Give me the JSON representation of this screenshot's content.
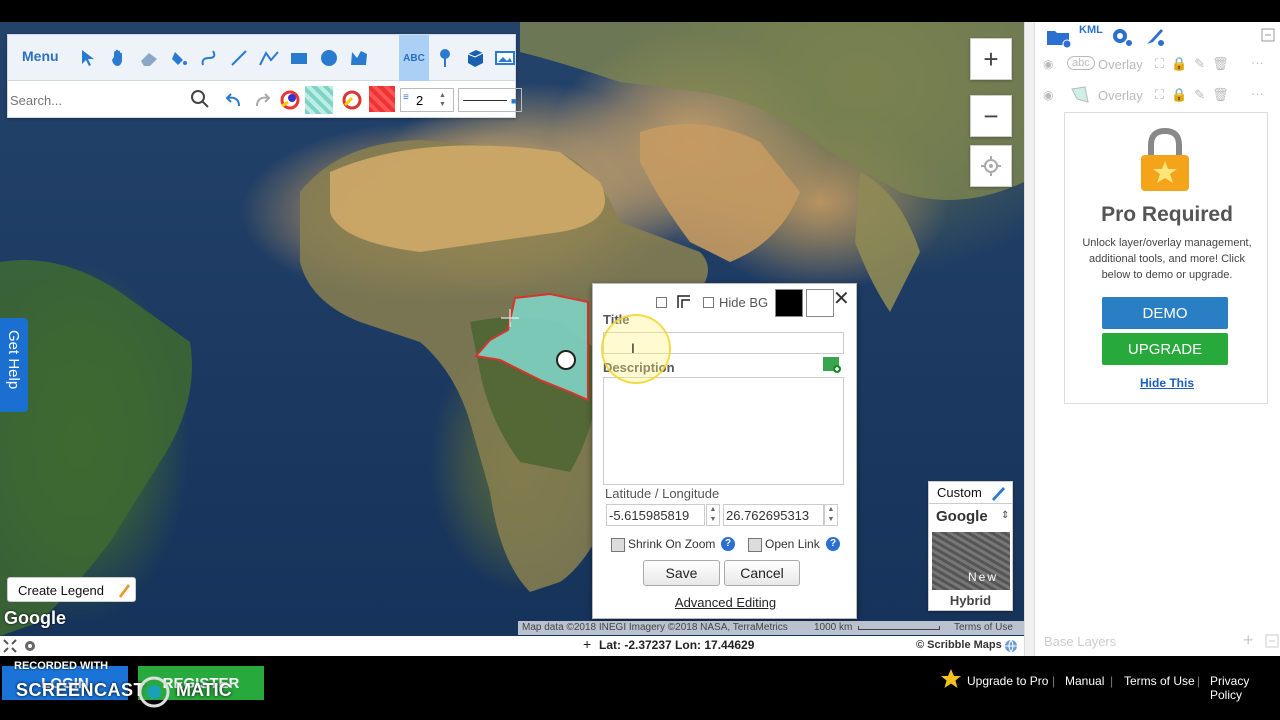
{
  "toolbar": {
    "menu_label": "Menu",
    "tools": [
      "select-icon",
      "pan-icon",
      "eraser-icon",
      "fill-icon",
      "freehand-icon",
      "line-icon",
      "polyline-icon",
      "rectangle-icon",
      "circle-icon",
      "polygon-icon",
      "text-icon",
      "marker-icon",
      "3d-icon",
      "image-icon"
    ],
    "text_tool_label": "ABC",
    "search_placeholder": "Search...",
    "stroke_width": "2"
  },
  "zoom": {
    "in_label": "+",
    "out_label": "−"
  },
  "get_help": "Get Help",
  "dialog": {
    "hide_bg_label": "Hide BG",
    "title_label": "Title",
    "description_label": "Description",
    "latlon_label": "Latitude / Longitude",
    "latitude": "-5.615985819",
    "longitude": "26.762695313",
    "shrink_label": "Shrink On Zoom",
    "open_link_label": "Open Link",
    "save_label": "Save",
    "cancel_label": "Cancel",
    "advanced_label": "Advanced Editing",
    "close_label": "✕",
    "help_glyph": "?"
  },
  "map_type": {
    "custom_label": "Custom",
    "provider": "Google",
    "provider_arrow": "⇕",
    "thumb_label": "New",
    "hybrid_label": "Hybrid"
  },
  "legend_label": "Create Legend",
  "google_logo": "Google",
  "attribution": {
    "text": "Map data ©2018 INEGI Imagery ©2018 NASA, TerraMetrics",
    "scale": "1000 km",
    "terms": "Terms of Use"
  },
  "status": {
    "coords": "Lat: -2.37237 Lon: 17.44629",
    "brand": "© Scribble Maps"
  },
  "right_panel": {
    "kml_label": "KML",
    "overlay_rows": [
      {
        "badge": "abc",
        "label": "Overlay"
      },
      {
        "badge": "",
        "label": "Overlay"
      }
    ],
    "pro_title": "Pro Required",
    "pro_text": "Unlock layer/overlay management, additional tools, and more! Click below to demo or upgrade.",
    "demo_label": "DEMO",
    "upgrade_label": "UPGRADE",
    "hide_label": "Hide This",
    "base_layers_label": "Base Layers"
  },
  "bottom": {
    "login_label": "LOGIN",
    "register_label": "REGISTER",
    "recorded_label": "RECORDED WITH",
    "screencast_label": "SCREENCAST",
    "matic_label": "MATIC",
    "upgrade_pro": "Upgrade to Pro",
    "manual": "Manual",
    "terms": "Terms of Use",
    "privacy": "Privacy Policy",
    "separator": "|"
  },
  "colors": {
    "accent": "#2b6fd0",
    "polygon_fill": "#7fd3c4",
    "polygon_stroke": "#d9342b",
    "demo": "#2a7fc4",
    "upgrade": "#27a93c"
  }
}
